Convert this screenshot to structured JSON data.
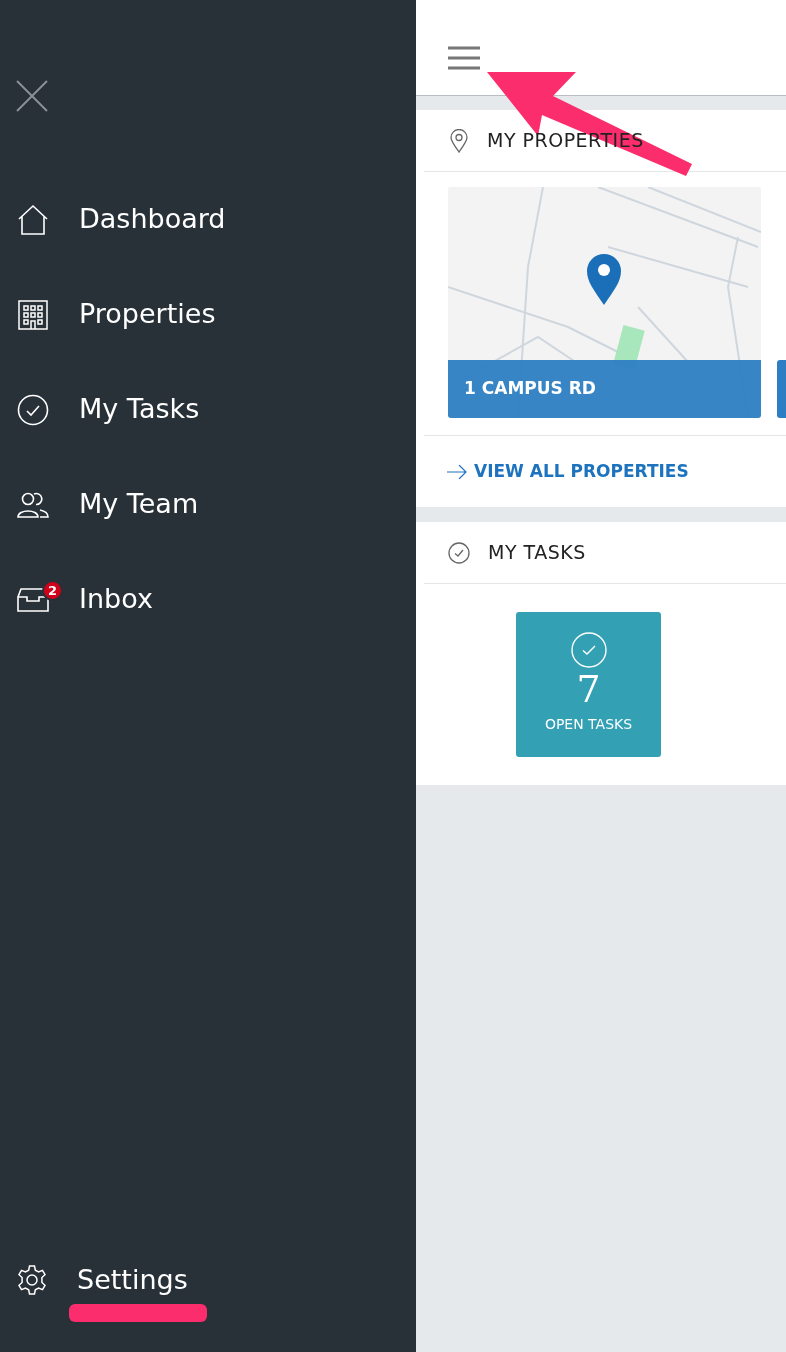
{
  "sidebar": {
    "items": [
      {
        "label": "Dashboard"
      },
      {
        "label": "Properties"
      },
      {
        "label": "My Tasks"
      },
      {
        "label": "My Team"
      },
      {
        "label": "Inbox",
        "badge": "2"
      }
    ],
    "footer_item": {
      "label": "Settings"
    }
  },
  "properties_section": {
    "title": "MY PROPERTIES",
    "cards": [
      {
        "address": "1 CAMPUS RD"
      }
    ],
    "link": "VIEW ALL PROPERTIES"
  },
  "tasks_section": {
    "title": "MY TASKS",
    "tiles": [
      {
        "count": "7",
        "label": "OPEN TASKS"
      }
    ]
  }
}
